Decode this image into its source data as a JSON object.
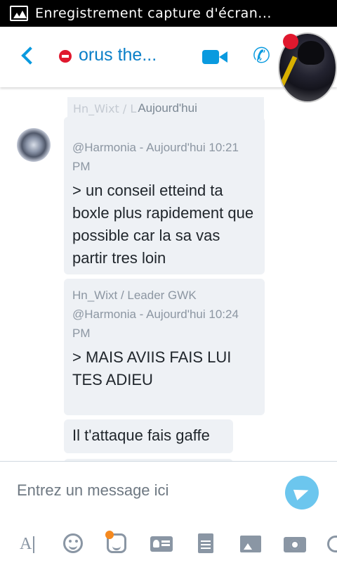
{
  "status_bar": {
    "notification_text": "Enregistrement capture d'écran..."
  },
  "header": {
    "contact_name": "orus the...",
    "presence": "busy"
  },
  "chat": {
    "date_separator": "Aujourd'hui",
    "date_overlap_fragment": "Hn_Wixt / L",
    "messages": [
      {
        "quote_meta_line1": "@Harmonia - Aujourd'hui 10:21",
        "quote_meta_line2": "PM",
        "quote_text": "> un conseil etteind ta boxle plus rapidement que possible car la sa vas partir tres loin"
      },
      {
        "quote_meta_line1": "Hn_Wixt / Leader GWK",
        "quote_meta_line2": "@Harmonia - Aujourd'hui 10:24",
        "quote_meta_line3": "PM",
        "quote_text": "> MAIS AVIIS FAIS LUI TES ADIEU"
      },
      {
        "text": "Il t'attaque fais gaffe"
      }
    ]
  },
  "composer": {
    "placeholder": "Entrez un message ici"
  },
  "toolbar": {
    "text_tool_glyph": "A"
  },
  "colors": {
    "accent": "#0a9adf",
    "presence_busy": "#e0182e",
    "bubble_bg": "#eef1f5",
    "send_button": "#6cc6ee",
    "sticker_badge": "#f5891f"
  }
}
